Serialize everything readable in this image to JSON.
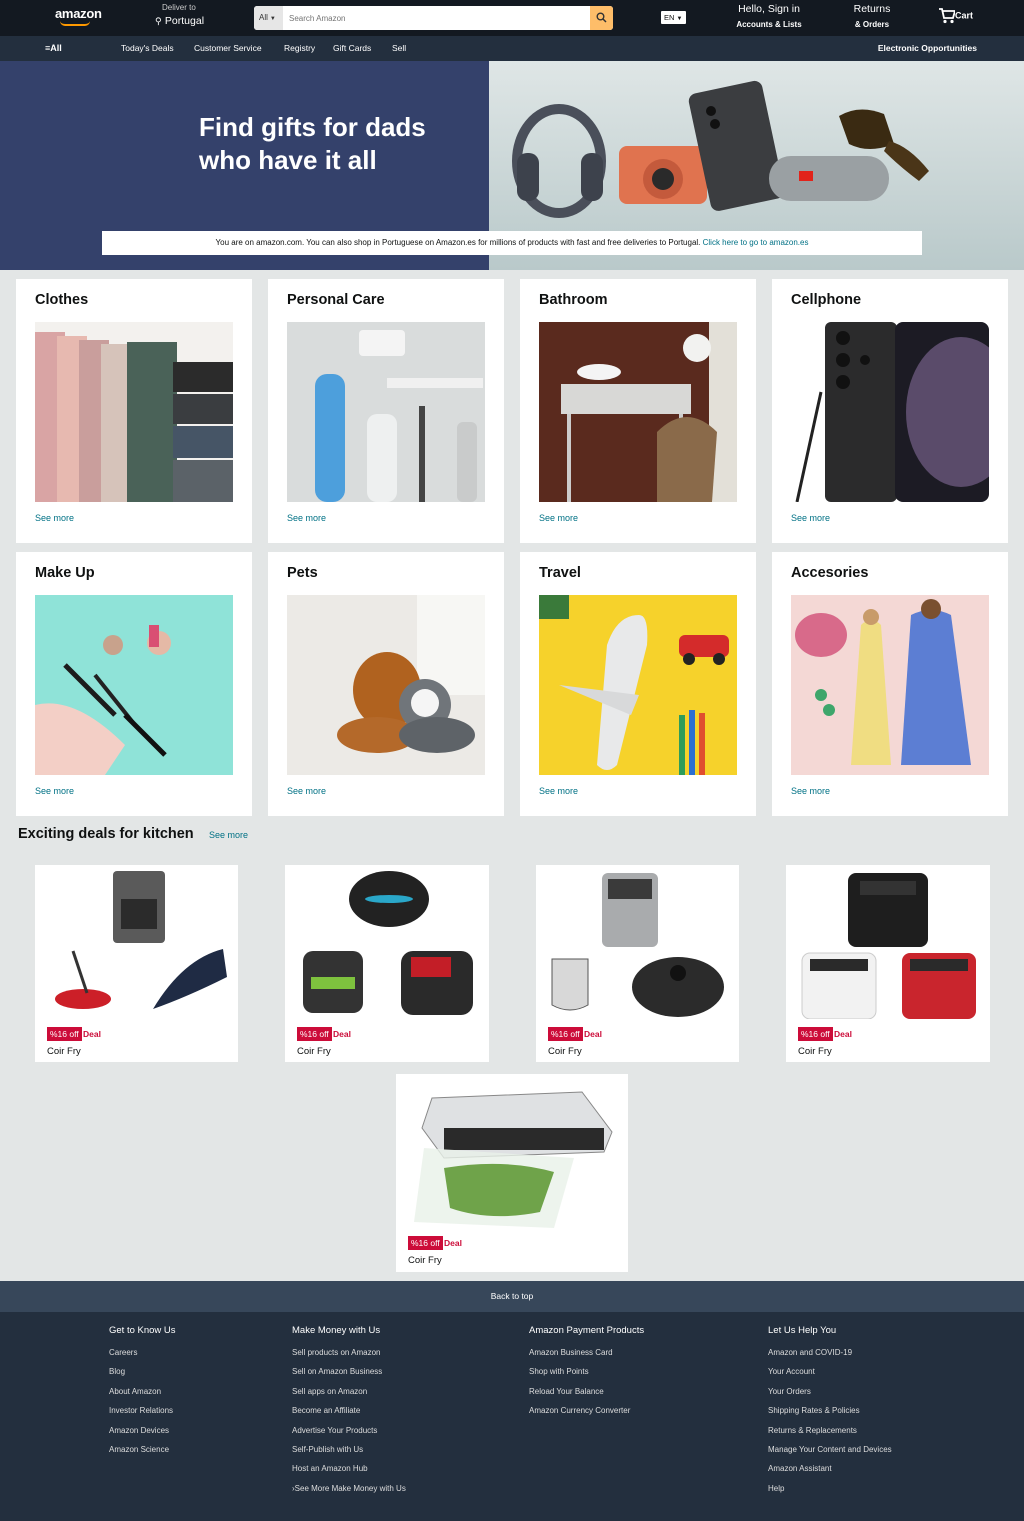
{
  "header": {
    "logo": "amazon",
    "deliver_label": "Deliver to",
    "deliver_location": "Portugal",
    "search_category": "All",
    "search_placeholder": "Search Amazon",
    "language": "EN",
    "account_line1": "Hello, Sign in",
    "account_line2": "Accounts & Lists",
    "returns_line1": "Returns",
    "returns_line2": "& Orders",
    "cart_label": "Cart",
    "accent_color": "#febd69"
  },
  "nav": {
    "all": "All",
    "items": [
      "Today's Deals",
      "Customer Service",
      "Registry",
      "Gift Cards",
      "Sell"
    ],
    "promo": "Electronic Opportunities"
  },
  "hero": {
    "title": "Find gifts for dads who have it all",
    "notice_text": "You are on amazon.com. You can also shop in Portuguese on Amazon.es for millions of products with fast and free deliveries to Portugal. ",
    "notice_link": "Click here to go to amazon.es"
  },
  "categories": [
    {
      "title": "Clothes",
      "link": "See more"
    },
    {
      "title": "Personal Care",
      "link": "See more"
    },
    {
      "title": "Bathroom",
      "link": "See more"
    },
    {
      "title": "Cellphone",
      "link": "See more"
    },
    {
      "title": "Make Up",
      "link": "See more"
    },
    {
      "title": "Pets",
      "link": "See more"
    },
    {
      "title": "Travel",
      "link": "See more"
    },
    {
      "title": "Accesories",
      "link": "See more"
    }
  ],
  "deals": {
    "title": "Exciting deals for kitchen",
    "see_more": "See more",
    "items": [
      {
        "badge": "%16 off",
        "label": "Deal",
        "name": "Coir Fry"
      },
      {
        "badge": "%16 off",
        "label": "Deal",
        "name": "Coir Fry"
      },
      {
        "badge": "%16 off",
        "label": "Deal",
        "name": "Coir Fry"
      },
      {
        "badge": "%16 off",
        "label": "Deal",
        "name": "Coir Fry"
      },
      {
        "badge": "%16 off",
        "label": "Deal",
        "name": "Coir Fry"
      }
    ]
  },
  "footer": {
    "back_to_top": "Back to top",
    "columns": [
      {
        "title": "Get to Know Us",
        "links": [
          "Careers",
          "Blog",
          "About Amazon",
          "Investor Relations",
          "Amazon Devices",
          "Amazon Science"
        ]
      },
      {
        "title": "Make Money with Us",
        "links": [
          "Sell products on Amazon",
          "Sell on Amazon Business",
          "Sell apps on Amazon",
          "Become an Affiliate",
          "Advertise Your Products",
          "Self-Publish with Us",
          "Host an Amazon Hub",
          "›See More Make Money with Us"
        ]
      },
      {
        "title": "Amazon Payment Products",
        "links": [
          "Amazon Business Card",
          "Shop with Points",
          "Reload Your Balance",
          "Amazon Currency Converter"
        ]
      },
      {
        "title": "Let Us Help You",
        "links": [
          "Amazon and COVID-19",
          "Your Account",
          "Your Orders",
          "Shipping Rates & Policies",
          "Returns & Replacements",
          "Manage Your Content and Devices",
          "Amazon Assistant",
          "Help"
        ]
      }
    ]
  }
}
